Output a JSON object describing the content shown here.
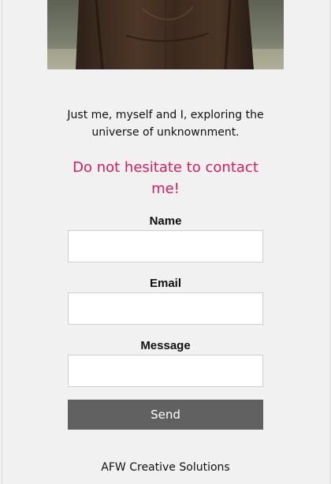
{
  "intro": {
    "bio": "Just me, myself and I, exploring the universe of unknownment.",
    "cta": "Do not hesitate to contact me!"
  },
  "form": {
    "name_label": "Name",
    "name_value": "",
    "email_label": "Email",
    "email_value": "",
    "message_label": "Message",
    "message_value": "",
    "send_label": "Send"
  },
  "footer": {
    "text": "AFW Creative Solutions"
  },
  "colors": {
    "background": "#f1f1f1",
    "accent": "#d81b60",
    "button": "#606060"
  }
}
